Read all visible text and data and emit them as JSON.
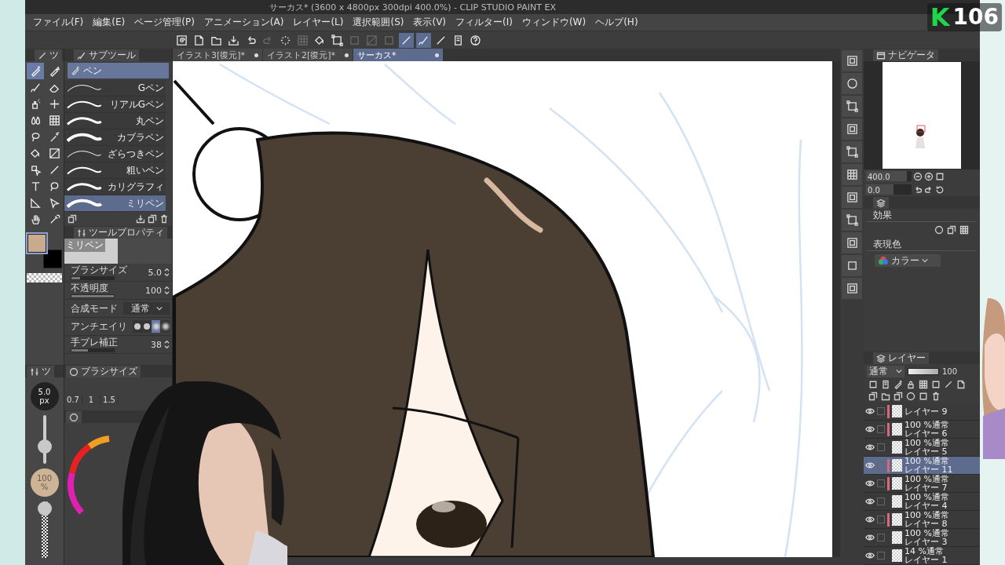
{
  "window": {
    "title": "サーカス* (3600 x 4800px 300dpi 400.0%) - CLIP STUDIO PAINT EX"
  },
  "menu": [
    "ファイル(F)",
    "編集(E)",
    "ページ管理(P)",
    "アニメーション(A)",
    "レイヤー(L)",
    "選択範囲(S)",
    "表示(V)",
    "フィルター(I)",
    "ウィンドウ(W)",
    "ヘルプ(H)"
  ],
  "toolbar": [
    {
      "kind": "spiral",
      "on": false,
      "disabled": false
    },
    {
      "kind": "new",
      "on": false,
      "disabled": false
    },
    {
      "kind": "open",
      "on": false,
      "disabled": false
    },
    {
      "kind": "save",
      "on": false,
      "disabled": false
    },
    {
      "kind": "undo",
      "on": false,
      "disabled": false
    },
    {
      "kind": "redo",
      "on": false,
      "disabled": true
    },
    {
      "kind": "dots",
      "on": false,
      "disabled": false
    },
    {
      "kind": "grid",
      "on": false,
      "disabled": true
    },
    {
      "kind": "bucket",
      "on": false,
      "disabled": false
    },
    {
      "kind": "frame",
      "on": false,
      "disabled": false
    },
    {
      "kind": "square",
      "on": false,
      "disabled": true
    },
    {
      "kind": "gradient",
      "on": false,
      "disabled": true
    },
    {
      "kind": "square",
      "on": false,
      "disabled": true
    },
    {
      "kind": "line",
      "on": true,
      "disabled": false
    },
    {
      "kind": "brush",
      "on": true,
      "disabled": false
    },
    {
      "kind": "line",
      "on": false,
      "disabled": false
    },
    {
      "kind": "device",
      "on": false,
      "disabled": false
    },
    {
      "kind": "help",
      "on": false,
      "disabled": false
    }
  ],
  "doc_tabs": [
    {
      "label": "イラスト3[復元]*",
      "selected": false
    },
    {
      "label": "イラスト2[復元]*",
      "selected": false
    },
    {
      "label": "サーカス*",
      "selected": true
    }
  ],
  "tool_panel": {
    "tab": "ツ",
    "tools": [
      {
        "kind": "pen",
        "selected": true
      },
      {
        "kind": "pencil",
        "selected": false
      },
      {
        "kind": "brush",
        "selected": false
      },
      {
        "kind": "eraser",
        "selected": false
      },
      {
        "kind": "spray",
        "selected": false
      },
      {
        "kind": "plus",
        "selected": false
      },
      {
        "kind": "drops",
        "selected": false
      },
      {
        "kind": "grid",
        "selected": false
      },
      {
        "kind": "lasso",
        "selected": false
      },
      {
        "kind": "wand",
        "selected": false
      },
      {
        "kind": "bucket",
        "selected": false
      },
      {
        "kind": "gradient",
        "selected": false
      },
      {
        "kind": "object",
        "selected": false
      },
      {
        "kind": "line",
        "selected": false
      },
      {
        "kind": "text",
        "selected": false
      },
      {
        "kind": "balloon",
        "selected": false
      },
      {
        "kind": "ruler",
        "selected": false
      },
      {
        "kind": "select",
        "selected": false
      },
      {
        "kind": "hand",
        "selected": false
      },
      {
        "kind": "dropper",
        "selected": false
      }
    ]
  },
  "color_swatches": [
    {
      "color": "#c9aa8c",
      "selected": true
    },
    {
      "color": "#000000",
      "selected": false
    }
  ],
  "subtool": {
    "tab": "サブツール",
    "group": "ペン",
    "brushes": [
      {
        "name": "Gペン",
        "selected": false
      },
      {
        "name": "リアルGペン",
        "selected": false
      },
      {
        "name": "丸ペン",
        "selected": false
      },
      {
        "name": "カブラペン",
        "selected": false
      },
      {
        "name": "ざらつきペン",
        "selected": false
      },
      {
        "name": "粗いペン",
        "selected": false
      },
      {
        "name": "カリグラフィ",
        "selected": false
      },
      {
        "name": "ミリペン",
        "selected": true
      }
    ]
  },
  "tool_property": {
    "tab": "ツールプロパティ",
    "preview_label": "ミリペン",
    "rows": [
      {
        "kind": "slider",
        "label": "ブラシサイズ",
        "value": "5.0",
        "level": 0.2
      },
      {
        "kind": "slider",
        "label": "不透明度",
        "value": "100",
        "level": 1
      },
      {
        "kind": "select",
        "label": "合成モード",
        "value": "通常"
      },
      {
        "kind": "choice",
        "label": "アンチエイリ",
        "choices": [
          {
            "selected": false
          },
          {
            "selected": false
          },
          {
            "selected": true
          },
          {
            "selected": false
          }
        ]
      },
      {
        "kind": "slider",
        "label": "手ブレ補正",
        "value": "38",
        "level": 0.38
      }
    ]
  },
  "brush_size_panel": {
    "tab": "ブラシサイズ",
    "sizes": [
      "0.7",
      "1",
      "1.5"
    ]
  },
  "quick_panel": {
    "tab": "ツ",
    "size": "5.0",
    "size_unit": "px",
    "size_slider": {
      "level": 0.3
    },
    "opacity": "100",
    "opacity_unit": "%",
    "opacity_slider": {
      "level": 1
    }
  },
  "navigator": {
    "tab": "ナビゲータ",
    "zoom": "400.0",
    "zoom_slider": {
      "level": 0.9
    },
    "rotation": "0.0",
    "rotation_slider": {
      "level": 0.6
    }
  },
  "layer_property": {
    "effect_label": "効果",
    "color_label": "表現色",
    "color_mode": "カラー"
  },
  "layers": {
    "tab": "レイヤー",
    "blend": "通常",
    "opacity": "100",
    "opacity_slider": {
      "level": 1
    },
    "items": [
      {
        "name": "レイヤー 9",
        "visible": true,
        "marked": true,
        "selected": false
      },
      {
        "mode": "100 %通常",
        "name": "レイヤー 6",
        "visible": true,
        "marked": true,
        "selected": false
      },
      {
        "mode": "100 %通常",
        "name": "レイヤー 5",
        "visible": true,
        "marked": false,
        "selected": false
      },
      {
        "mode": "100 %通常",
        "name": "レイヤー 11",
        "visible": true,
        "marked": true,
        "selected": true
      },
      {
        "mode": "100 %通常",
        "name": "レイヤー 7",
        "visible": true,
        "marked": true,
        "selected": false
      },
      {
        "mode": "100 %通常",
        "name": "レイヤー 4",
        "visible": true,
        "marked": false,
        "selected": false
      },
      {
        "mode": "100 %通常",
        "name": "レイヤー 8",
        "visible": true,
        "marked": true,
        "selected": false
      },
      {
        "mode": "100 %通常",
        "name": "レイヤー 3",
        "visible": true,
        "marked": false,
        "selected": false
      },
      {
        "mode": "14 %通常",
        "name": "レイヤー 1",
        "visible": true,
        "marked": false,
        "selected": false
      }
    ]
  },
  "stream_badge": {
    "letter": "K",
    "count": "106"
  }
}
